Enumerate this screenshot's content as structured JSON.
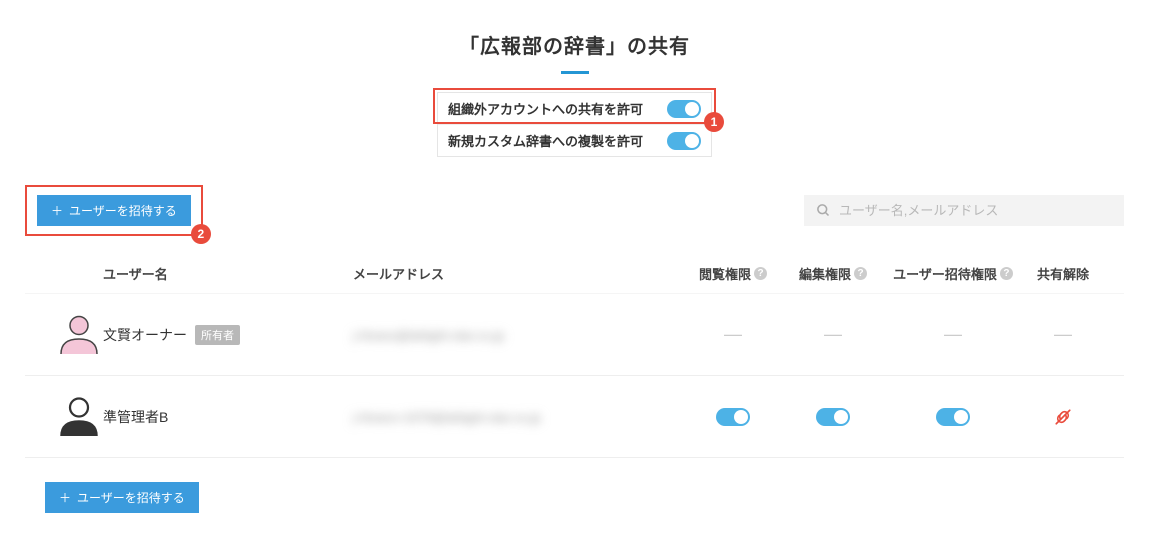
{
  "title": "「広報部の辞書」の共有",
  "settings": {
    "external_share_label": "組織外アカウントへの共有を許可",
    "external_share_on": true,
    "copy_dict_label": "新規カスタム辞書への複製を許可",
    "copy_dict_on": true
  },
  "callouts": {
    "one": "1",
    "two": "2"
  },
  "buttons": {
    "invite": "ユーザーを招待する"
  },
  "search": {
    "placeholder": "ユーザー名,メールアドレス"
  },
  "columns": {
    "name": "ユーザー名",
    "email": "メールアドレス",
    "view": "閲覧権限",
    "edit": "編集権限",
    "invite": "ユーザー招待権限",
    "unshare": "共有解除"
  },
  "rows": [
    {
      "current_user": true,
      "avatar": "pink",
      "name": "文賢オーナー",
      "owner_badge": "所有者",
      "email": "j-hirano@delight-star.co.jp",
      "view": "dash",
      "edit": "dash",
      "invite": "dash",
      "unshare": "dash"
    },
    {
      "current_user": false,
      "avatar": "mono",
      "name": "準管理者B",
      "owner_badge": null,
      "email": "j-hirano+1978@delight-star.co.jp",
      "view": "on",
      "edit": "on",
      "invite": "on",
      "unshare": "unlink"
    }
  ]
}
